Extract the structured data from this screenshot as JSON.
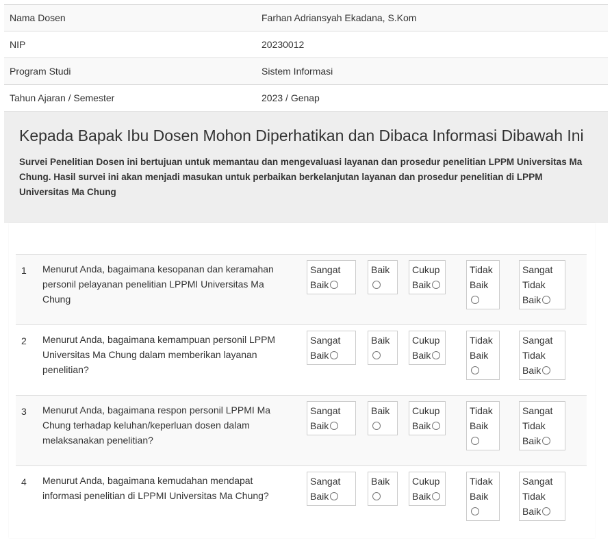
{
  "info": [
    {
      "label": "Nama Dosen",
      "value": "Farhan Adriansyah Ekadana, S.Kom"
    },
    {
      "label": "NIP",
      "value": "20230012"
    },
    {
      "label": "Program Studi",
      "value": "Sistem Informasi"
    },
    {
      "label": "Tahun Ajaran / Semester",
      "value": "2023 / Genap"
    }
  ],
  "notice": {
    "title": "Kepada Bapak Ibu Dosen Mohon Diperhatikan dan Dibaca Informasi Dibawah Ini",
    "body": "Survei Penelitian Dosen ini bertujuan untuk memantau dan mengevaluasi layanan dan prosedur penelitian LPPM Universitas Ma Chung. Hasil survei ini akan menjadi masukan untuk perbaikan berkelanjutan layanan dan prosedur penelitian di LPPM Universitas Ma Chung"
  },
  "options": {
    "o1": [
      "Sangat",
      "Baik"
    ],
    "o2": [
      "Baik"
    ],
    "o3": [
      "Cukup",
      "Baik"
    ],
    "o4": [
      "Tidak",
      "Baik"
    ],
    "o5": [
      "Sangat",
      "Tidak",
      "Baik"
    ]
  },
  "questions": [
    {
      "no": "1",
      "text": "Menurut Anda, bagaimana kesopanan dan keramahan personil pelayanan penelitian LPPMI Universitas Ma Chung"
    },
    {
      "no": "2",
      "text": "Menurut Anda, bagaimana kemampuan personil LPPM Universitas Ma Chung dalam memberikan layanan penelitian?"
    },
    {
      "no": "3",
      "text": "Menurut Anda, bagaimana respon personil LPPMI Ma Chung terhadap keluhan/keperluan dosen dalam melaksanakan penelitian?"
    },
    {
      "no": "4",
      "text": "Menurut Anda, bagaimana kemudahan mendapat informasi penelitian di LPPMI Universitas Ma Chung?"
    }
  ]
}
